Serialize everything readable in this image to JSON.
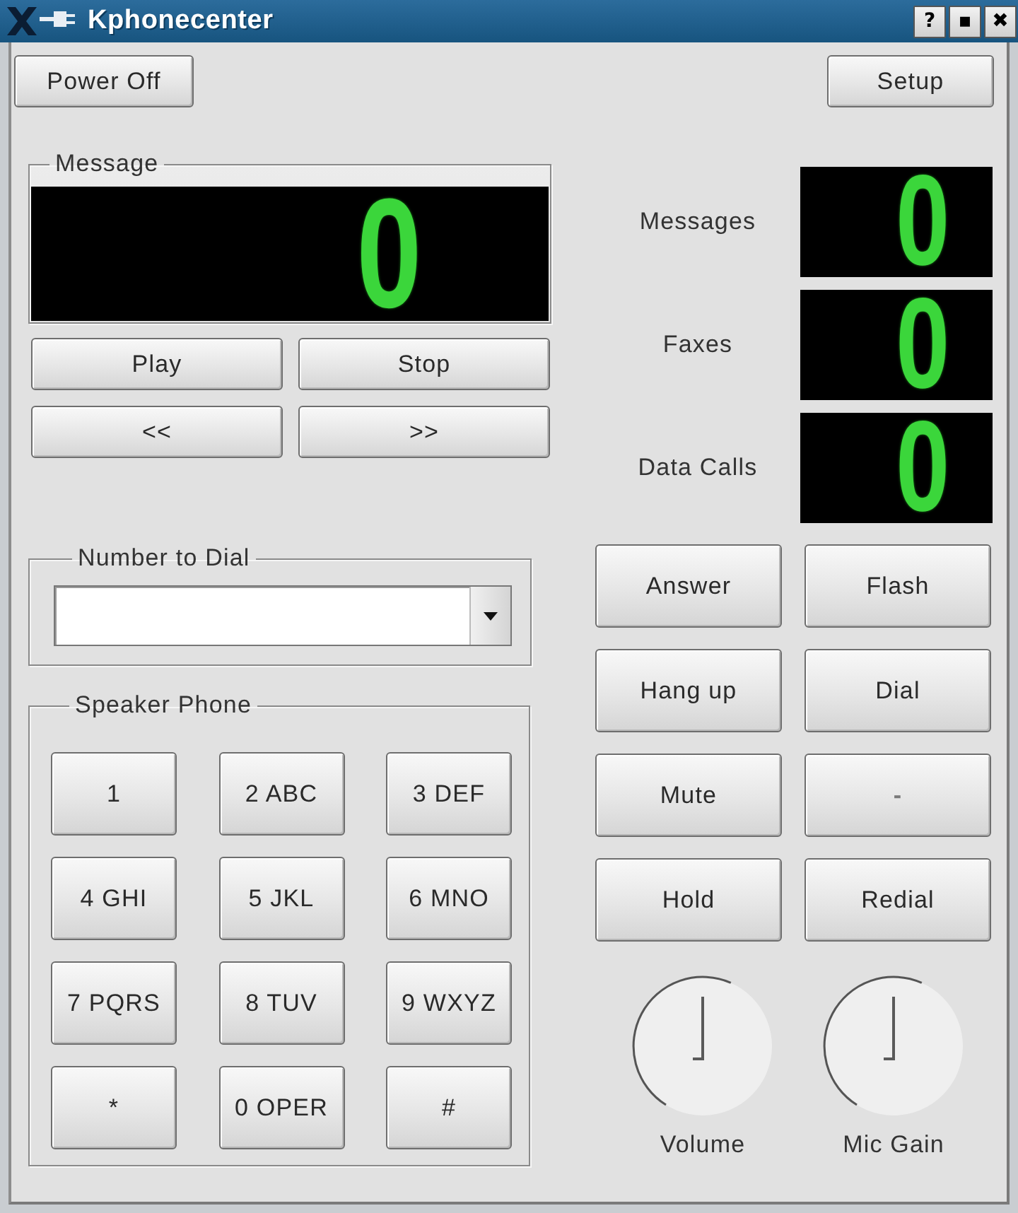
{
  "window": {
    "title": "Kphonecenter",
    "buttons": [
      "?",
      "▪",
      "✖"
    ]
  },
  "toolbar": {
    "power_button": "Power Off",
    "setup_button": "Setup"
  },
  "message": {
    "title": "Message",
    "display": "0",
    "buttons": [
      "Play",
      "Stop",
      "<<",
      ">>"
    ]
  },
  "counters": [
    {
      "label": "Messages",
      "value": "0"
    },
    {
      "label": "Faxes",
      "value": "0"
    },
    {
      "label": "Data Calls",
      "value": "0"
    }
  ],
  "number_to_dial": {
    "title": "Number to Dial"
  },
  "speaker_phone": {
    "title": "Speaker Phone",
    "keys": [
      "1",
      "2 ABC",
      "3 DEF",
      "4 GHI",
      "5 JKL",
      "6 MNO",
      "7 PQRS",
      "8 TUV",
      "9 WXYZ",
      "*",
      "0 OPER",
      "#"
    ]
  },
  "call_buttons": [
    {
      "label": "Answer",
      "disabled": false
    },
    {
      "label": "Flash",
      "disabled": false
    },
    {
      "label": "Hang up",
      "disabled": false
    },
    {
      "label": "Dial",
      "disabled": false
    },
    {
      "label": "Mute",
      "disabled": false
    },
    {
      "label": "-",
      "disabled": true
    },
    {
      "label": "Hold",
      "disabled": false
    },
    {
      "label": "Redial",
      "disabled": false
    }
  ],
  "knobs": [
    {
      "label": "Volume",
      "level": 0.5
    },
    {
      "label": "Mic Gain",
      "level": 0.5
    }
  ]
}
